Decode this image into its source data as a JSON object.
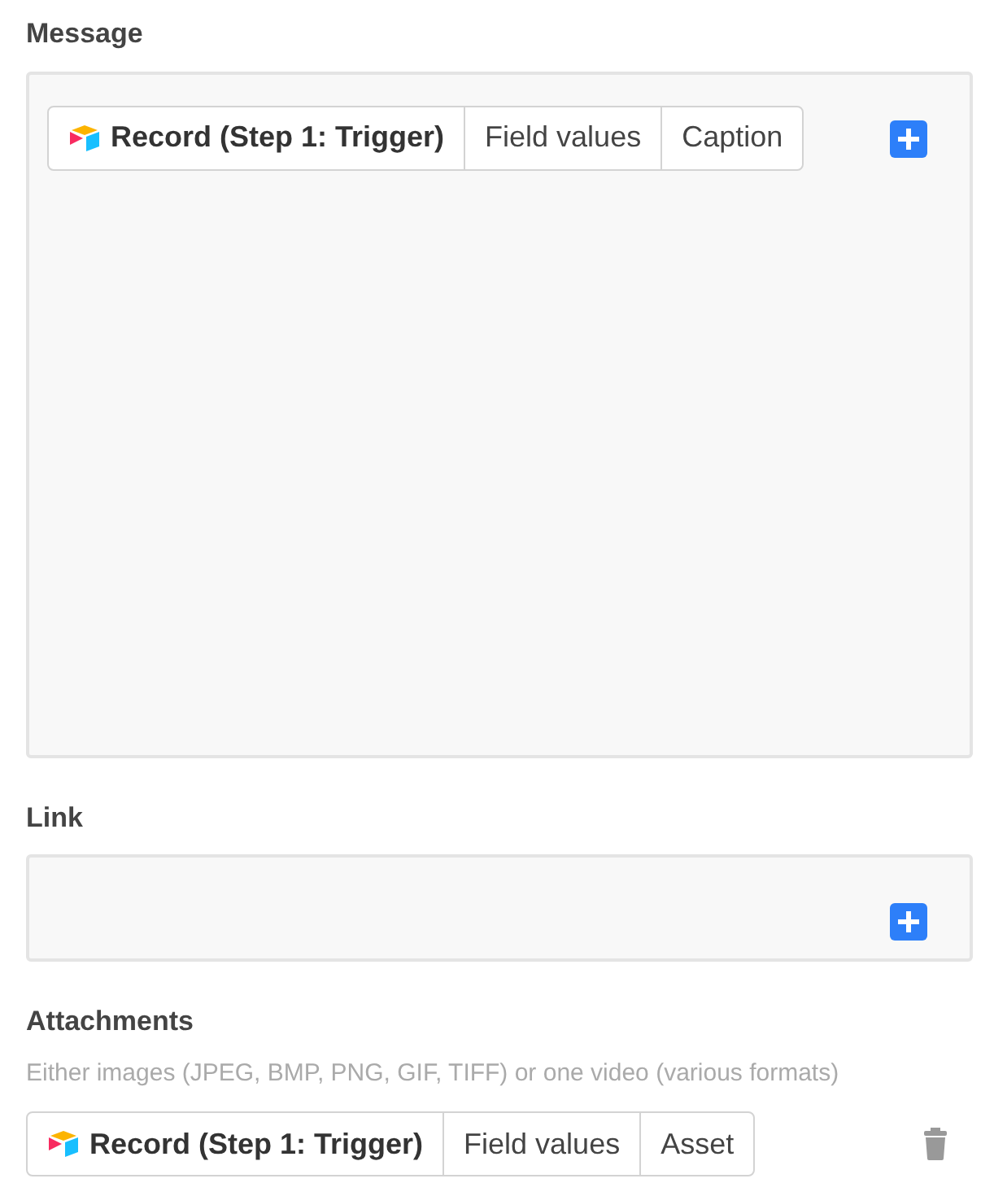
{
  "fields": [
    {
      "label": "Message",
      "kind": "textarea",
      "token": {
        "source": "Record (Step 1: Trigger)",
        "parts": [
          "Field values",
          "Caption"
        ]
      }
    },
    {
      "label": "Link",
      "kind": "input"
    },
    {
      "label": "Attachments",
      "kind": "attachment",
      "hint": "Either images (JPEG, BMP, PNG, GIF, TIFF) or one video (various formats)",
      "token": {
        "source": "Record (Step 1: Trigger)",
        "parts": [
          "Field values",
          "Asset"
        ]
      }
    }
  ]
}
